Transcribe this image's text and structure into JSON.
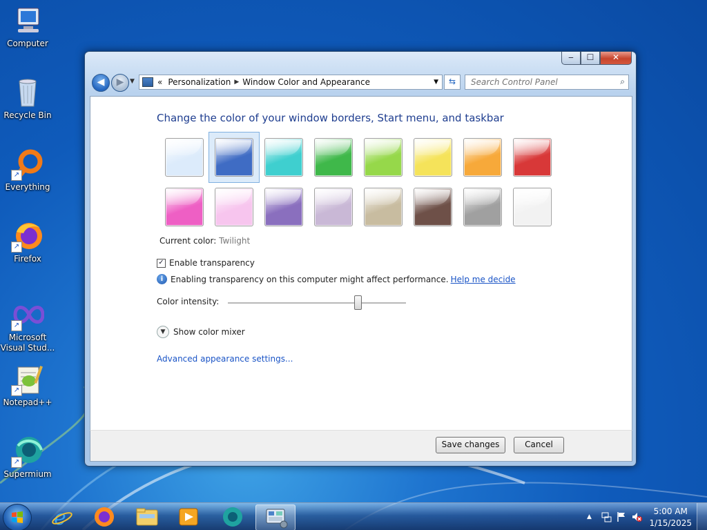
{
  "desktop": {
    "icons": [
      {
        "label": "Computer",
        "shortcut": false
      },
      {
        "label": "Recycle Bin",
        "shortcut": false
      },
      {
        "label": "Everything",
        "shortcut": true
      },
      {
        "label": "Firefox",
        "shortcut": true
      },
      {
        "label": "Microsoft Visual Stud...",
        "shortcut": true
      },
      {
        "label": "Notepad++",
        "shortcut": true
      },
      {
        "label": "Supermium",
        "shortcut": true
      }
    ]
  },
  "window": {
    "controls": {
      "minimize": "‒",
      "maximize": "☐",
      "close": "✕"
    },
    "breadcrumb": [
      "Personalization",
      "Window Color and Appearance"
    ],
    "breadcrumb_prefix": "«",
    "search_placeholder": "Search Control Panel",
    "heading": "Change the color of your window borders, Start menu, and taskbar",
    "swatches": [
      {
        "color": "#dcebfb",
        "selected": false
      },
      {
        "color": "#3f6cc4",
        "selected": true
      },
      {
        "color": "#3fcfcf",
        "selected": false
      },
      {
        "color": "#3fb84a",
        "selected": false
      },
      {
        "color": "#96d84a",
        "selected": false
      },
      {
        "color": "#f5e35a",
        "selected": false
      },
      {
        "color": "#f7a93a",
        "selected": false
      },
      {
        "color": "#d83838",
        "selected": false
      },
      {
        "color": "#ee5fc4",
        "selected": false
      },
      {
        "color": "#f7c5ee",
        "selected": false
      },
      {
        "color": "#8a6fbe",
        "selected": false
      },
      {
        "color": "#c9b8d6",
        "selected": false
      },
      {
        "color": "#c8bca0",
        "selected": false
      },
      {
        "color": "#6e5048",
        "selected": false
      },
      {
        "color": "#a0a0a0",
        "selected": false
      },
      {
        "color": "#f2f2f2",
        "selected": false
      }
    ],
    "current_color_label": "Current color:",
    "current_color_value": "Twilight",
    "transparency_label": "Enable transparency",
    "transparency_checked": true,
    "info_text": "Enabling transparency on this computer might affect performance.",
    "help_link": "Help me decide",
    "intensity_label": "Color intensity:",
    "intensity_value": 0.73,
    "mixer_label": "Show color mixer",
    "advanced_link": "Advanced appearance settings...",
    "save_label": "Save changes",
    "cancel_label": "Cancel"
  },
  "taskbar": {
    "apps": [
      "internet-explorer-icon",
      "firefox-icon",
      "file-explorer-icon",
      "media-player-icon",
      "supermium-icon",
      "control-panel-icon"
    ],
    "tray_arrow": "▲",
    "time": "5:00 AM",
    "date": "1/15/2025"
  }
}
